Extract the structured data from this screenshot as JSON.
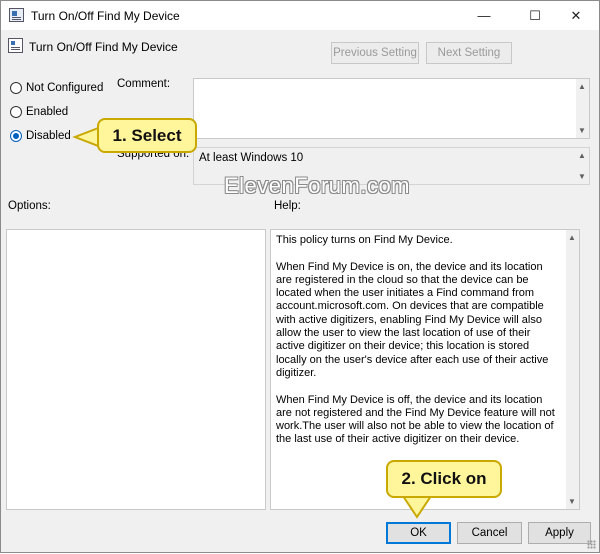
{
  "window": {
    "title": "Turn On/Off Find My Device",
    "minimize_glyph": "—",
    "maximize_glyph": "☐",
    "close_glyph": "✕"
  },
  "header": {
    "policy_title": "Turn On/Off Find My Device",
    "previous_setting": "Previous Setting",
    "next_setting": "Next Setting"
  },
  "state": {
    "options": [
      {
        "label": "Not Configured",
        "checked": false
      },
      {
        "label": "Enabled",
        "checked": false
      },
      {
        "label": "Disabled",
        "checked": true
      }
    ]
  },
  "comment": {
    "label": "Comment:",
    "value": ""
  },
  "supported": {
    "label": "Supported on:",
    "value": "At least Windows 10"
  },
  "options_label": "Options:",
  "help": {
    "label": "Help:",
    "text": "This policy turns on Find My Device.\n\nWhen Find My Device is on, the device and its location are registered in the cloud so that the device can be located when the user initiates a Find command from account.microsoft.com. On devices that are compatible with active digitizers, enabling Find My Device will also allow the user to view the last location of use of their active digitizer on their device; this location is stored locally on the user's device after each use of their active digitizer.\n\nWhen Find My Device is off, the device and its location are not registered and the Find My Device feature will not work.The user will also not be able to view the location of the last use of their active digitizer on their device."
  },
  "footer": {
    "ok": "OK",
    "cancel": "Cancel",
    "apply": "Apply"
  },
  "annotations": {
    "step1": "1. Select",
    "step2": "2. Click on",
    "watermark": "ElevenForum.com",
    "callout_fill": "#fff59a",
    "callout_border": "#c9a800"
  }
}
